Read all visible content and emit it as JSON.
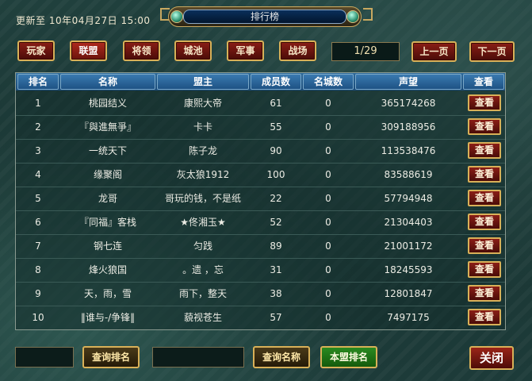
{
  "header": {
    "update_text": "更新至  10年04月27日  15:00",
    "title": "排行榜"
  },
  "tabs": [
    {
      "label": "玩家",
      "active": false
    },
    {
      "label": "联盟",
      "active": true
    },
    {
      "label": "将领",
      "active": false
    },
    {
      "label": "城池",
      "active": false
    },
    {
      "label": "军事",
      "active": false
    },
    {
      "label": "战场",
      "active": false
    }
  ],
  "pager": {
    "indicator": "1/29",
    "prev_label": "上一页",
    "next_label": "下一页"
  },
  "table": {
    "columns": [
      "排名",
      "名称",
      "盟主",
      "成员数",
      "名城数",
      "声望",
      "查看"
    ],
    "view_label": "查看",
    "rows": [
      {
        "rank": "1",
        "name": "桃园结义",
        "leader": "康熙大帝",
        "members": "61",
        "cities": "0",
        "prestige": "365174268"
      },
      {
        "rank": "2",
        "name": "『與進無爭』",
        "leader": "卡卡",
        "members": "55",
        "cities": "0",
        "prestige": "309188956"
      },
      {
        "rank": "3",
        "name": "一统天下",
        "leader": "陈子龙",
        "members": "90",
        "cities": "0",
        "prestige": "113538476"
      },
      {
        "rank": "4",
        "name": "缘聚阁",
        "leader": "灰太狼1912",
        "members": "100",
        "cities": "0",
        "prestige": "83588619"
      },
      {
        "rank": "5",
        "name": "龙哥",
        "leader": "哥玩的钱，不是纸",
        "members": "22",
        "cities": "0",
        "prestige": "57794948"
      },
      {
        "rank": "6",
        "name": "『同福』客栈",
        "leader": "★佟湘玉★",
        "members": "52",
        "cities": "0",
        "prestige": "21304403"
      },
      {
        "rank": "7",
        "name": "钢七连",
        "leader": "匀践",
        "members": "89",
        "cities": "0",
        "prestige": "21001172"
      },
      {
        "rank": "8",
        "name": "烽火狼国",
        "leader": "。遗 ，忘",
        "members": "31",
        "cities": "0",
        "prestige": "18245593"
      },
      {
        "rank": "9",
        "name": "天，雨，雪",
        "leader": "雨下，整天",
        "members": "38",
        "cities": "0",
        "prestige": "12801847"
      },
      {
        "rank": "10",
        "name": "‖谁与-/争锋‖",
        "leader": "藐视苍生",
        "members": "57",
        "cities": "0",
        "prestige": "7497175"
      }
    ]
  },
  "footer": {
    "rank_input_value": "",
    "query_rank_label": "查询排名",
    "name_input_value": "",
    "query_name_label": "查询名称",
    "my_rank_label": "本盟排名",
    "close_label": "关闭"
  },
  "colors": {
    "button_red": "#8a1e16",
    "button_border_gold": "#d8b058",
    "header_blue": "#2e6a9a",
    "green_button": "#2a8a20"
  }
}
